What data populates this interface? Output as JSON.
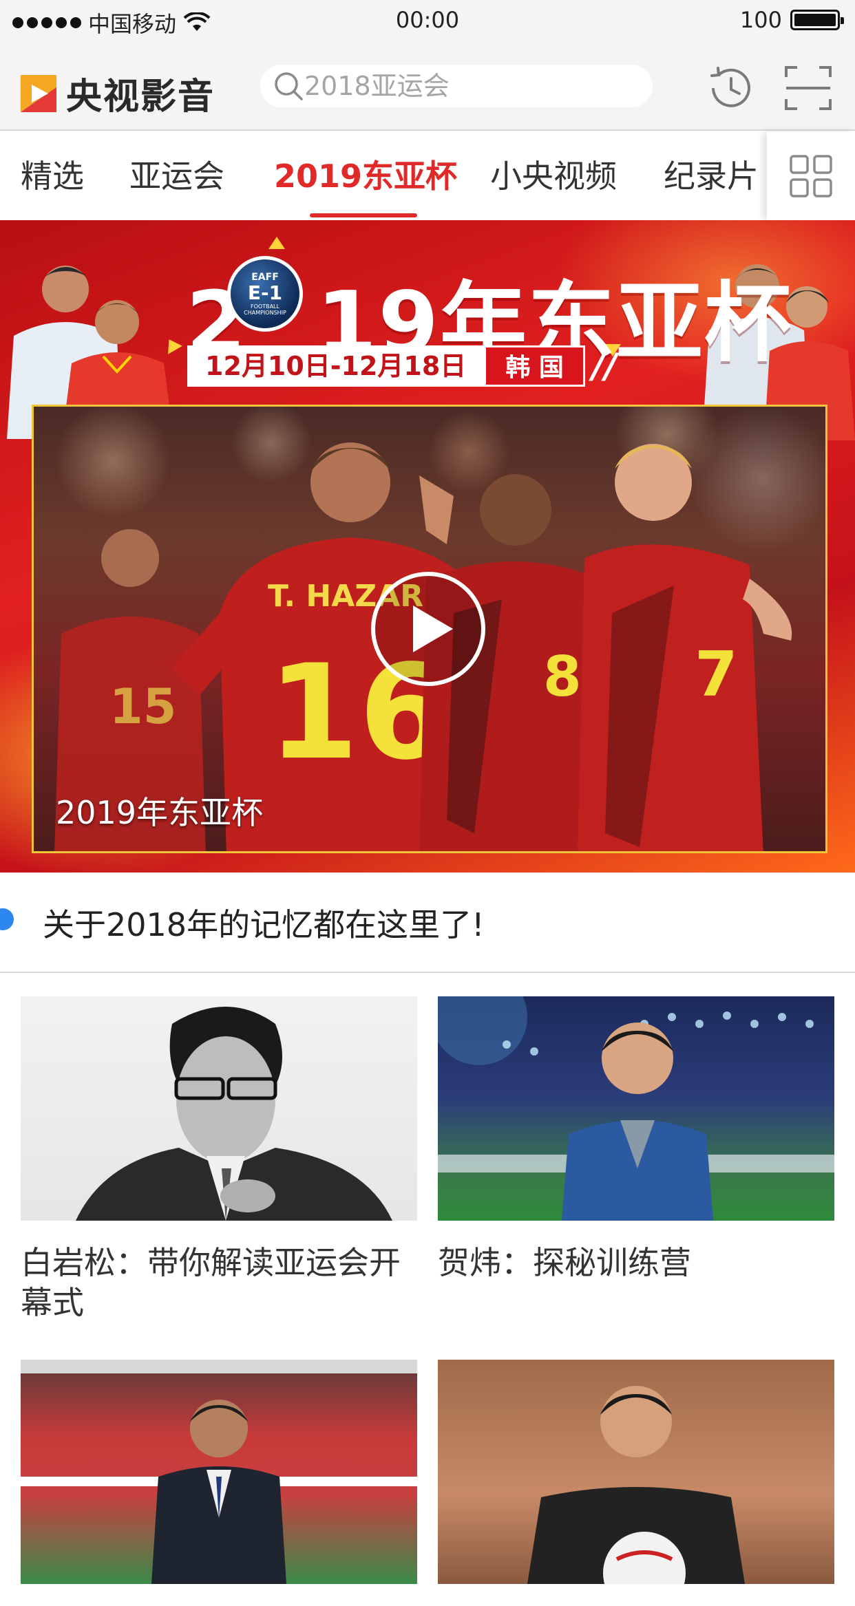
{
  "status_bar": {
    "carrier": "中国移动",
    "time": "00:00",
    "battery": "100"
  },
  "header": {
    "app_name": "央视影音",
    "search_placeholder": "2018亚运会",
    "icons": [
      "history-icon",
      "scan-icon"
    ]
  },
  "tabs": {
    "items": [
      "精选",
      "亚运会",
      "2019东亚杯",
      "小央视频",
      "纪录片"
    ],
    "active_index": 2,
    "grid_icon": "grid-icon"
  },
  "banner": {
    "title_pre": "2",
    "title_post": "19年东亚杯",
    "badge_top": "EAFF",
    "badge_main": "E-1",
    "badge_sub": "FOOTBALL CHAMPIONSHIP",
    "dates": "12月10日-12月18日",
    "country": "韩 国",
    "slashes": "//",
    "video_caption": "2019年东亚杯",
    "jersey_name": "T. HAZARD",
    "jersey_16": "16",
    "jersey_8": "8",
    "jersey_7": "7",
    "jersey_15": "15"
  },
  "notice": {
    "text": "关于2018年的记忆都在这里了!"
  },
  "cards": [
    {
      "title": "白岩松：带你解读亚运会开幕式"
    },
    {
      "title": "贺炜：探秘训练营"
    },
    {
      "title": ""
    },
    {
      "title": ""
    }
  ],
  "colors": {
    "accent": "#e02a2a",
    "notice_dot": "#2b86f0",
    "banner_red": "#d8151c"
  }
}
